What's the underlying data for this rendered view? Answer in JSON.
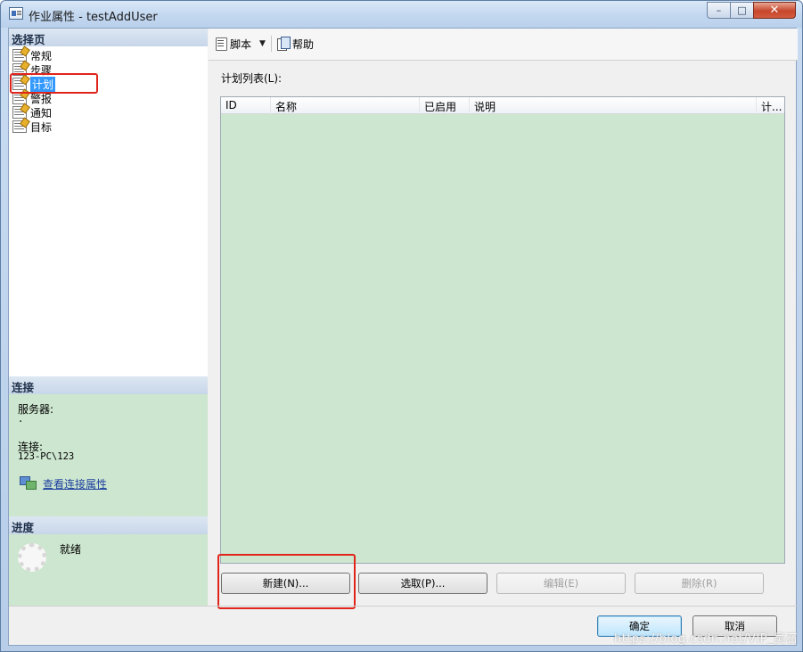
{
  "window": {
    "title": "作业属性 - testAddUser",
    "controls": {
      "minimize": "–",
      "maximize": "□",
      "close": "✕"
    }
  },
  "sidebar": {
    "select_page_header": "选择页",
    "items": [
      {
        "label": "常规",
        "icon": "page-icon"
      },
      {
        "label": "步骤",
        "icon": "page-icon"
      },
      {
        "label": "计划",
        "icon": "page-icon",
        "selected": true
      },
      {
        "label": "警报",
        "icon": "page-icon"
      },
      {
        "label": "通知",
        "icon": "page-icon"
      },
      {
        "label": "目标",
        "icon": "page-icon"
      }
    ],
    "connection_header": "连接",
    "server_label": "服务器:",
    "server_value": ".",
    "connection_label": "连接:",
    "connection_value": "123-PC\\123",
    "view_connection_link": "查看连接属性",
    "progress_header": "进度",
    "progress_status": "就绪"
  },
  "toolbar": {
    "script_label": "脚本",
    "help_label": "帮助"
  },
  "main": {
    "list_label": "计划列表(L):",
    "columns": [
      "ID",
      "名称",
      "已启用",
      "说明",
      "计..."
    ],
    "rows": []
  },
  "buttons": {
    "new": "新建(N)...",
    "pick": "选取(P)...",
    "edit": "编辑(E)",
    "delete": "删除(R)",
    "ok": "确定",
    "cancel": "取消"
  },
  "watermark": "https://blog.csdn.net/VIP_吴石"
}
